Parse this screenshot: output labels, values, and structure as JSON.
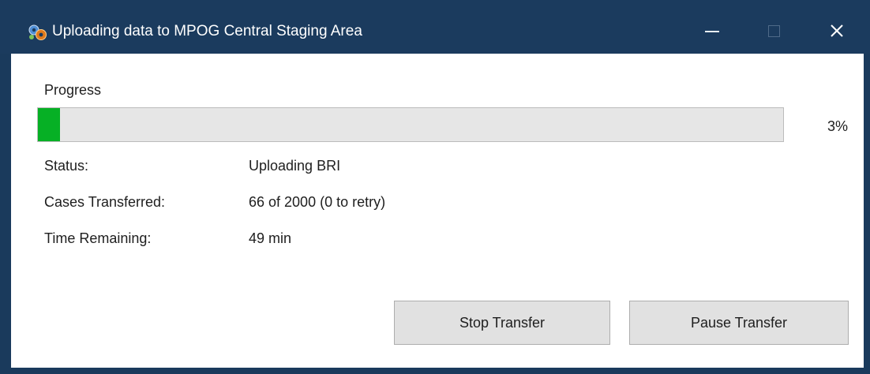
{
  "window": {
    "title": "Uploading data to MPOG Central Staging Area",
    "icon": "gears-globe-icon",
    "controls": {
      "minimize_glyph": "—",
      "close_glyph": "✕"
    }
  },
  "progress": {
    "label": "Progress",
    "value": 0.03,
    "percent_text": "3%",
    "fill_color": "#06b025"
  },
  "details": [
    {
      "label": "Status:",
      "value": "Uploading BRI"
    },
    {
      "label": "Cases Transferred:",
      "value": "66 of 2000 (0 to retry)"
    },
    {
      "label": "Time Remaining:",
      "value": "49 min"
    }
  ],
  "buttons": {
    "stop_label": "Stop Transfer",
    "pause_label": "Pause Transfer"
  },
  "colors": {
    "titlebar": "#1b3b5e",
    "client": "#ffffff",
    "button_face": "#e1e1e1"
  }
}
